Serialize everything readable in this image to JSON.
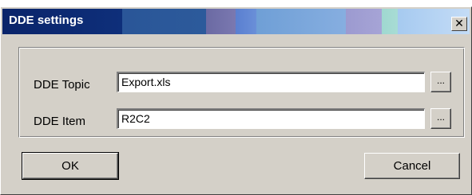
{
  "dialog": {
    "title": "DDE settings",
    "close_glyph": "✕",
    "close_icon": "close-icon"
  },
  "fields": {
    "topic": {
      "label": "DDE Topic",
      "value": "Export.xls",
      "browse_label": "..."
    },
    "item": {
      "label": "DDE Item",
      "value": "R2C2",
      "browse_label": "..."
    }
  },
  "buttons": {
    "ok_label": "OK",
    "cancel_label": "Cancel"
  },
  "colors": {
    "face": "#d4d0c8",
    "titlebar_active": "#0a246a",
    "title_text": "#ffffff"
  }
}
